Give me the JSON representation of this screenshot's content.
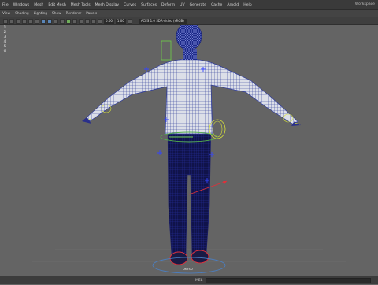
{
  "menubar": {
    "items": [
      "File",
      "Windows",
      "Mesh",
      "Edit Mesh",
      "Mesh Tools",
      "Mesh Display",
      "Curves",
      "Surfaces",
      "Deform",
      "UV",
      "Generate",
      "Cache",
      "Arnold",
      "Help"
    ],
    "right_text": "Workspace"
  },
  "panel_menu": {
    "items": [
      "View",
      "Shading",
      "Lighting",
      "Show",
      "Renderer",
      "Panels"
    ]
  },
  "toolbar": {
    "field1": "0.00",
    "field2": "1.00",
    "colorspace": "ACES 1.0 SDR-video (sRGB)"
  },
  "sidebar": {
    "items": [
      "1",
      "2",
      "3",
      "4",
      "5",
      "6"
    ]
  },
  "viewport": {
    "camera_label": "persp",
    "background_color": "#646464",
    "wire_color": "#2f3c9a",
    "control_curve_color": "#d8e23a",
    "locator_color": "#3344ff",
    "foot_control_color": "#e0303a"
  },
  "statusbar": {
    "label": "MEL"
  }
}
